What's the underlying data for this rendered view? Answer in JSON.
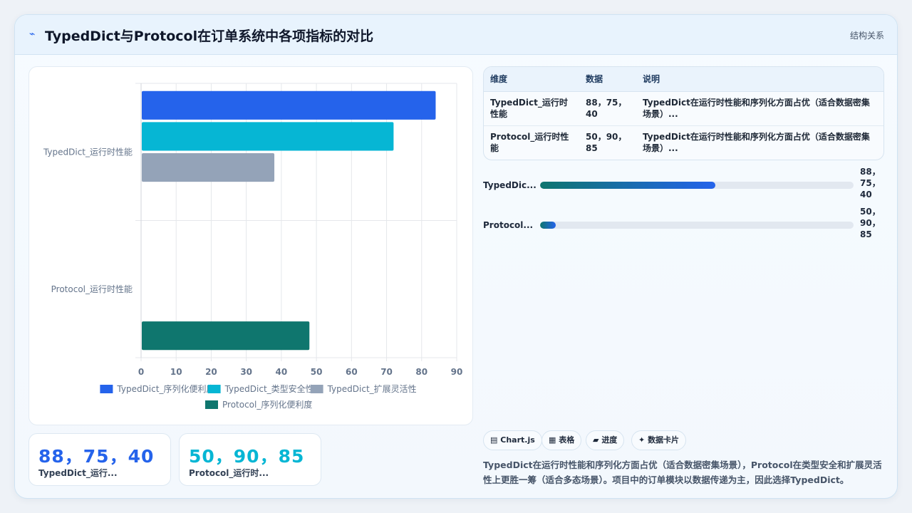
{
  "header": {
    "icon": "sparkline-icon",
    "title": "TypedDict与Protocol在订单系统中各项指标的对比",
    "link": "结构关系"
  },
  "chart_data": {
    "type": "bar",
    "orientation": "horizontal",
    "categories": [
      "TypedDict_运行时性能",
      "Protocol_运行时性能"
    ],
    "series": [
      {
        "name": "TypedDict_序列化便利度",
        "color": "#2563eb",
        "values": [
          84,
          null
        ]
      },
      {
        "name": "TypedDict_类型安全性",
        "color": "#06b6d4",
        "values": [
          72,
          null
        ]
      },
      {
        "name": "TypedDict_扩展灵活性",
        "color": "#94a3b8",
        "values": [
          38,
          null
        ]
      },
      {
        "name": "Protocol_序列化便利度",
        "color": "#0f766e",
        "values": [
          null,
          48
        ]
      }
    ],
    "xlim": [
      0,
      90
    ],
    "xticks": [
      "0",
      "10",
      "20",
      "30",
      "40",
      "50",
      "60",
      "70",
      "80",
      "90"
    ],
    "grid": true,
    "legend_position": "bottom"
  },
  "stats": [
    {
      "value": "88，75，40",
      "label": "TypedDict_运行...",
      "color": "#2563eb"
    },
    {
      "value": "50，90，85",
      "label": "Protocol_运行时...",
      "color": "#06b6d4"
    }
  ],
  "table": {
    "headers": [
      "维度",
      "数据",
      "说明"
    ],
    "rows": [
      {
        "dim": "TypedDict_运行时性能",
        "data": "88，75，40",
        "desc": "TypedDict在运行时性能和序列化方面占优（适合数据密集场景）..."
      },
      {
        "dim": "Protocol_运行时性能",
        "data": "50，90，85",
        "desc": "TypedDict在运行时性能和序列化方面占优（适合数据密集场景）..."
      }
    ]
  },
  "progress": [
    {
      "label": "TypedDic...",
      "value_text": "88，75，40",
      "fraction": 0.56
    },
    {
      "label": "Protocol...",
      "value_text": "50，90，85",
      "fraction": 0.05
    }
  ],
  "tags": [
    {
      "icon": "chart-icon",
      "glyph": "▤",
      "label": "Chart.js"
    },
    {
      "icon": "table-icon",
      "glyph": "▦",
      "label": "表格"
    },
    {
      "icon": "progress-icon",
      "glyph": "▰",
      "label": "进度"
    },
    {
      "icon": "sparkle-icon",
      "glyph": "✦",
      "label": "数据卡片"
    }
  ],
  "summary": "TypedDict在运行时性能和序列化方面占优（适合数据密集场景），Protocol在类型安全和扩展灵活性上更胜一筹（适合多态场景）。项目中的订单模块以数据传递为主，因此选择TypedDict。"
}
